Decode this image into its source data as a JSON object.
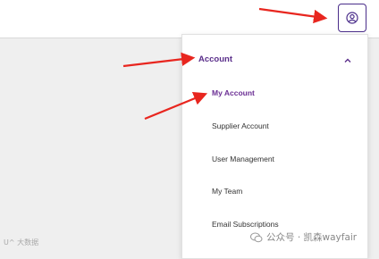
{
  "header": {
    "account_icon": "user-circle-icon"
  },
  "account_menu": {
    "section_label": "Account",
    "chevron_icon": "chevron-up-icon",
    "items": [
      {
        "label": "My Account",
        "active": true
      },
      {
        "label": "Supplier Account",
        "active": false
      },
      {
        "label": "User Management",
        "active": false
      },
      {
        "label": "My Team",
        "active": false
      },
      {
        "label": "Email Subscriptions",
        "active": false
      }
    ]
  },
  "annotations": {
    "arrow_color": "#e8261f"
  },
  "watermark": {
    "left_text": "U^ 大数据",
    "right_text": "公众号 · 凯森wayfair"
  },
  "colors": {
    "accent": "#5a2e8a",
    "active_item": "#6b2f94"
  }
}
